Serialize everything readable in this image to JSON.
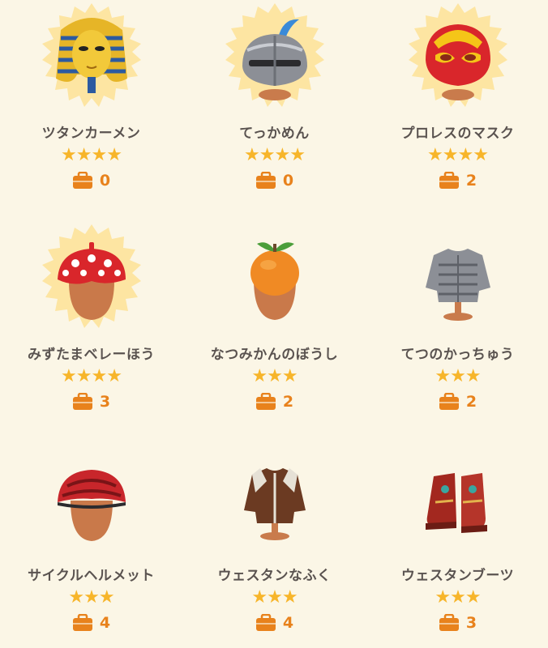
{
  "items": [
    {
      "name": "ツタンカーメン",
      "stars": "★★★★",
      "count": "0",
      "icon": "pharaoh-mask-icon",
      "badge": true
    },
    {
      "name": "てっかめん",
      "stars": "★★★★",
      "count": "0",
      "icon": "knight-helmet-icon",
      "badge": true
    },
    {
      "name": "プロレスのマスク",
      "stars": "★★★★",
      "count": "2",
      "icon": "wrestling-mask-icon",
      "badge": true
    },
    {
      "name": "みずたまベレーほう",
      "stars": "★★★★",
      "count": "3",
      "icon": "polka-dot-beret-icon",
      "badge": true
    },
    {
      "name": "なつみかんのぼうし",
      "stars": "★★★",
      "count": "2",
      "icon": "orange-hat-icon",
      "badge": false
    },
    {
      "name": "てつのかっちゅう",
      "stars": "★★★",
      "count": "2",
      "icon": "iron-armor-icon",
      "badge": false
    },
    {
      "name": "サイクルヘルメット",
      "stars": "★★★",
      "count": "4",
      "icon": "bike-helmet-icon",
      "badge": false
    },
    {
      "name": "ウェスタンなふく",
      "stars": "★★★",
      "count": "4",
      "icon": "western-shirt-icon",
      "badge": false
    },
    {
      "name": "ウェスタンブーツ",
      "stars": "★★★",
      "count": "3",
      "icon": "western-boots-icon",
      "badge": false
    }
  ],
  "colors": {
    "background": "#fbf6e6",
    "star": "#f7b52a",
    "count": "#e8821c",
    "name": "#5a5350",
    "badge": "#fde5a2"
  }
}
